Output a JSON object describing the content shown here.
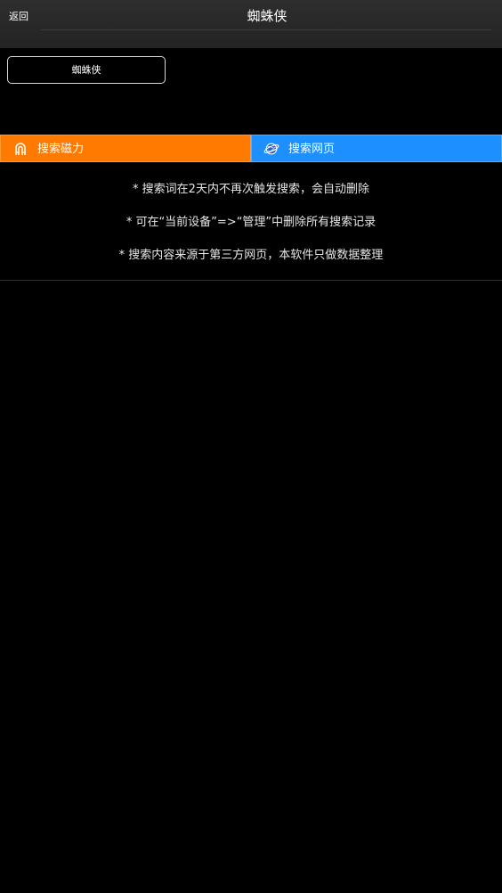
{
  "navbar": {
    "back_label": "返回",
    "title": "蜘蛛侠"
  },
  "query": {
    "keyword": "蜘蛛侠"
  },
  "tabs": [
    {
      "label": "搜索磁力",
      "color": "#ff7a00",
      "icon": "magnet-icon"
    },
    {
      "label": "搜索网页",
      "color": "#1e8fff",
      "icon": "browser-globe-icon"
    }
  ],
  "tips": [
    "* 搜索词在2天内不再次触发搜索，会自动删除",
    "* 可在“当前设备”=>“管理”中删除所有搜索记录",
    "* 搜索内容来源于第三方网页，本软件只做数据整理"
  ]
}
